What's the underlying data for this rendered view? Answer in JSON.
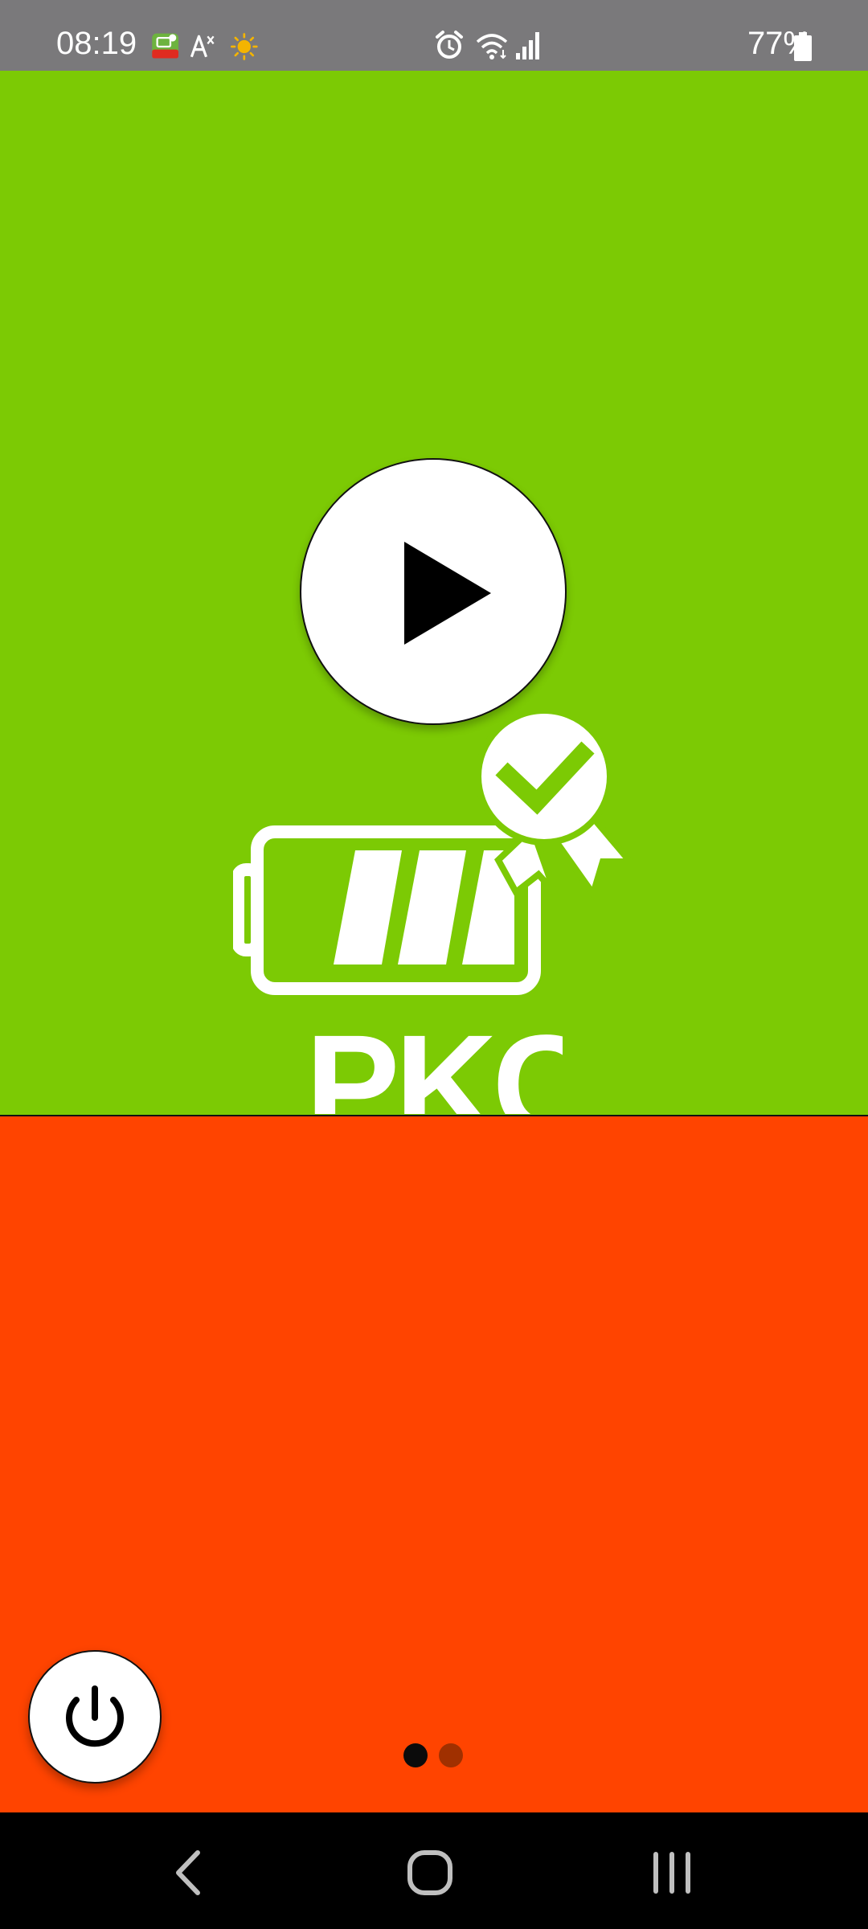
{
  "status_bar": {
    "time": "08:19",
    "battery_percent": "77%",
    "icons_left": [
      "pkc-app-icon",
      "accessibility-text-icon",
      "weather-sun-icon"
    ],
    "icons_right": [
      "alarm-icon",
      "wifi-icon",
      "signal-icon",
      "battery-icon"
    ]
  },
  "main": {
    "logo_text": "PKC",
    "play_icon": "play-icon",
    "logo_icon": "battery-certified-icon"
  },
  "bottom": {
    "power_icon": "power-icon",
    "pager": {
      "total": 2,
      "active": 1
    }
  },
  "nav_bar": {
    "buttons": [
      "back-icon",
      "home-icon",
      "recents-icon"
    ]
  },
  "colors": {
    "top_panel": "#7cca04",
    "bottom_panel": "#ff4400",
    "status_bar": "#7a797b",
    "nav_bar": "#000000",
    "dot_active": "#0b0b0b",
    "dot_inactive": "#a03000"
  }
}
